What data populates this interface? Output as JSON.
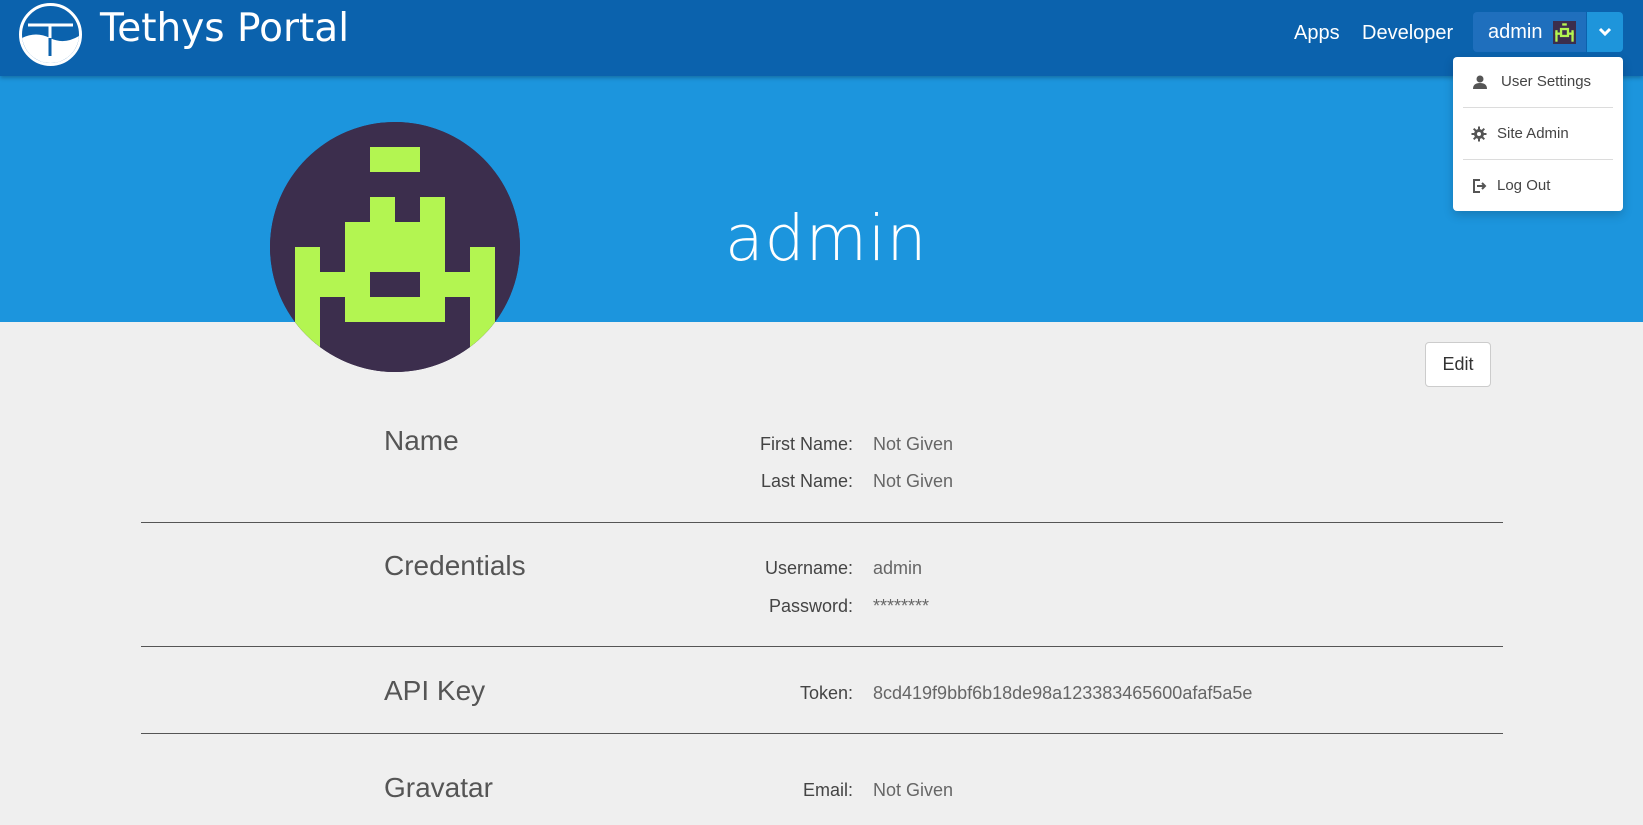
{
  "navbar": {
    "title": "Tethys Portal",
    "apps_link": "Apps",
    "developer_link": "Developer",
    "user_button_label": "admin",
    "background_color": "#0b62ad"
  },
  "dropdown": {
    "items": [
      {
        "label": "User Settings",
        "icon": "user-icon"
      },
      {
        "label": "Site Admin",
        "icon": "gear-icon"
      },
      {
        "label": "Log Out",
        "icon": "logout-icon"
      }
    ]
  },
  "profile": {
    "username_heading": "admin",
    "banner_color": "#1c95dd",
    "avatar_colors": {
      "background": "#3c2e4d",
      "figure": "#b3f551"
    },
    "edit_label": "Edit"
  },
  "sections": {
    "name": {
      "title": "Name",
      "first_name_label": "First Name:",
      "first_name_value": "Not Given",
      "last_name_label": "Last Name:",
      "last_name_value": "Not Given"
    },
    "credentials": {
      "title": "Credentials",
      "username_label": "Username:",
      "username_value": "admin",
      "password_label": "Password:",
      "password_value": "********"
    },
    "api_key": {
      "title": "API Key",
      "token_label": "Token:",
      "token_value": "8cd419f9bbf6b18de98a123383465600afaf5a5e"
    },
    "gravatar": {
      "title": "Gravatar",
      "email_label": "Email:",
      "email_value": "Not Given"
    }
  }
}
